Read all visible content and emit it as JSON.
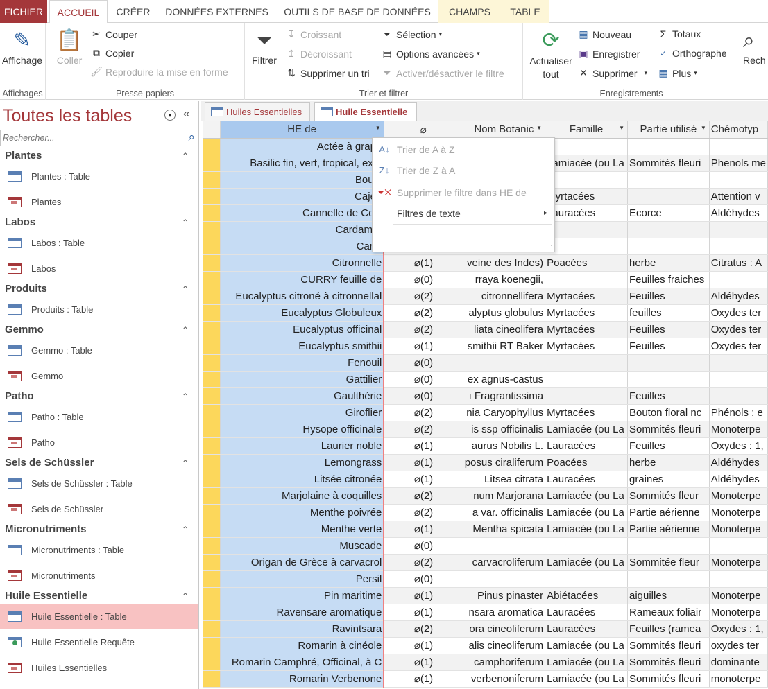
{
  "ribbon_tabs": [
    "FICHIER",
    "ACCUEIL",
    "CRÉER",
    "DONNÉES EXTERNES",
    "OUTILS DE BASE DE DONNÉES",
    "CHAMPS",
    "TABLE"
  ],
  "groups": {
    "affichages": {
      "label": "Affichages",
      "big": "Affichage"
    },
    "presse": {
      "label": "Presse-papiers",
      "paste": "Coller",
      "cut": "Couper",
      "copy": "Copier",
      "format": "Reproduire la mise en forme"
    },
    "tri": {
      "label": "Trier et filtrer",
      "filter": "Filtrer",
      "asc": "Croissant",
      "desc": "Décroissant",
      "clear": "Supprimer un tri",
      "selection": "Sélection",
      "advanced": "Options avancées",
      "toggle": "Activer/désactiver le filtre"
    },
    "enr": {
      "label": "Enregistrements",
      "refresh": "Actualiser tout",
      "new": "Nouveau",
      "save": "Enregistrer",
      "delete": "Supprimer",
      "totals": "Totaux",
      "spelling": "Orthographe",
      "more": "Plus"
    },
    "search": {
      "label_cut": "Rech"
    }
  },
  "nav": {
    "title": "Toutes les tables",
    "search_placeholder": "Rechercher...",
    "groups": [
      {
        "name": "Plantes",
        "items": [
          "Plantes : Table",
          "Plantes"
        ]
      },
      {
        "name": "Labos",
        "items": [
          "Labos : Table",
          "Labos"
        ]
      },
      {
        "name": "Produits",
        "items": [
          "Produits : Table"
        ]
      },
      {
        "name": "Gemmo",
        "items": [
          "Gemmo : Table",
          "Gemmo"
        ]
      },
      {
        "name": "Patho",
        "items": [
          "Patho : Table",
          "Patho"
        ]
      },
      {
        "name": "Sels de Schüssler",
        "items": [
          "Sels de Schüssler : Table",
          "Sels de Schüssler"
        ]
      },
      {
        "name": "Micronutriments",
        "items": [
          "Micronutriments : Table",
          "Micronutriments"
        ]
      },
      {
        "name": "Huile Essentielle",
        "items": [
          "Huile Essentielle : Table",
          "Huile Essentielle Requête",
          "Huiles Essentielles"
        ]
      }
    ]
  },
  "doc_tabs": [
    "Huiles Essentielles",
    "Huile Essentielle"
  ],
  "columns": [
    "HE de",
    "📎",
    "Nom Botanic",
    "Famille",
    "Partie utilisé",
    "Chémotyp"
  ],
  "rows": [
    [
      "Actée à grapp",
      "",
      "",
      "",
      "",
      ""
    ],
    [
      "Basilic fin, vert, tropical, exot",
      "",
      "",
      "Lamiacée (ou La",
      "Sommités fleuri",
      "Phenols me"
    ],
    [
      "Boule",
      "",
      "",
      "",
      "",
      ""
    ],
    [
      "Cajep",
      "",
      "",
      "Myrtacées",
      "",
      "Attention v"
    ],
    [
      "Cannelle de Ceyl",
      "",
      "",
      "Lauracées",
      "Ecorce",
      "Aldéhydes"
    ],
    [
      "Cardamor",
      "",
      "",
      "",
      "",
      ""
    ],
    [
      "Carot",
      "",
      "",
      "",
      "",
      ""
    ],
    [
      "Citronnelle",
      "(1)",
      "veine des Indes)",
      "Poacées",
      "herbe",
      "Citratus : A"
    ],
    [
      "CURRY feuille de",
      "(0)",
      "rraya koenegii,",
      "",
      "Feuilles fraiches",
      ""
    ],
    [
      "Eucalyptus citroné à citronnellal",
      "(2)",
      "citronnellifera",
      "Myrtacées",
      "Feuilles",
      "Aldéhydes"
    ],
    [
      "Eucalyptus Globuleux",
      "(2)",
      "alyptus globulus",
      "Myrtacées",
      "feuilles",
      "Oxydes ter"
    ],
    [
      "Eucalyptus officinal",
      "(2)",
      "liata cineolifera",
      "Myrtacées",
      "Feuilles",
      "Oxydes ter"
    ],
    [
      "Eucalyptus smithii",
      "(1)",
      "smithii RT Baker",
      "Myrtacées",
      "Feuilles",
      "Oxydes ter"
    ],
    [
      "Fenouil",
      "(0)",
      "",
      "",
      "",
      ""
    ],
    [
      "Gattilier",
      "(0)",
      "ex agnus-castus",
      "",
      "",
      ""
    ],
    [
      "Gaulthérie",
      "(0)",
      "ı Fragrantissima",
      "",
      "Feuilles",
      ""
    ],
    [
      "Giroflier",
      "(2)",
      "nia Caryophyllus",
      "Myrtacées",
      "Bouton floral nc",
      "Phénols : e"
    ],
    [
      "Hysope officinale",
      "(2)",
      "is ssp officinalis",
      "Lamiacée (ou La",
      "Sommités fleuri",
      "Monoterpe"
    ],
    [
      "Laurier noble",
      "(1)",
      "aurus Nobilis L.",
      "Lauracées",
      "Feuilles",
      "Oxydes : 1,"
    ],
    [
      "Lemongrass",
      "(1)",
      "posus ciraliferum",
      "Poacées",
      "herbe",
      "Aldéhydes"
    ],
    [
      "Litsée citronée",
      "(1)",
      "Litsea citrata",
      "Lauracées",
      "graines",
      "Aldéhydes"
    ],
    [
      "Marjolaine à coquilles",
      "(2)",
      "num Marjorana",
      "Lamiacée (ou La",
      "Sommités  fleur",
      "Monoterpe"
    ],
    [
      "Menthe poivrée",
      "(2)",
      "a var. officinalis",
      "Lamiacée (ou La",
      "Partie aérienne",
      "Monoterpe"
    ],
    [
      "Menthe verte",
      "(1)",
      "Mentha spicata",
      "Lamiacée (ou La",
      "Partie aérienne",
      "Monoterpe"
    ],
    [
      "Muscade",
      "(0)",
      "",
      "",
      "",
      ""
    ],
    [
      "Origan de Grèce à carvacrol",
      "(2)",
      "carvacroliferum",
      "Lamiacée (ou La",
      "Sommitée fleur",
      "Monoterpe"
    ],
    [
      "Persil",
      "(0)",
      "",
      "",
      "",
      ""
    ],
    [
      "Pin maritime",
      "(1)",
      "Pinus pinaster",
      "Abiétacées",
      "aiguilles",
      "Monoterpe"
    ],
    [
      "Ravensare aromatique",
      "(1)",
      "nsara aromatica",
      "Lauracées",
      "Rameaux foliair",
      "Monoterpe"
    ],
    [
      "Ravintsara",
      "(2)",
      "ora cineoliferum",
      "Lauracées",
      "Feuilles (ramea",
      "Oxydes : 1,"
    ],
    [
      "Romarin à cinéole",
      "(1)",
      "alis cineoliferum",
      "Lamiacée (ou La",
      "Sommités fleuri",
      "oxydes ter"
    ],
    [
      "Romarin Camphré, Officinal, à C",
      "(1)",
      "camphoriferum",
      "Lamiacée (ou La",
      "Sommités fleuri",
      "dominante"
    ],
    [
      "Romarin Verbenone",
      "(1)",
      "verbenoniferum",
      "Lamiacée (ou La",
      "Sommités fleuri",
      "monoterpe"
    ]
  ],
  "context_menu": {
    "sort_asc": "Trier de A à Z",
    "sort_desc": "Trier de Z à A",
    "clear_filter": "Supprimer le filtre dans HE de",
    "text_filters": "Filtres de texte"
  },
  "colors": {
    "accent": "#a4373a",
    "selector": "#fcd75b",
    "selected_col": "#c6dcf4",
    "nav_selected": "#f8c2c2"
  }
}
